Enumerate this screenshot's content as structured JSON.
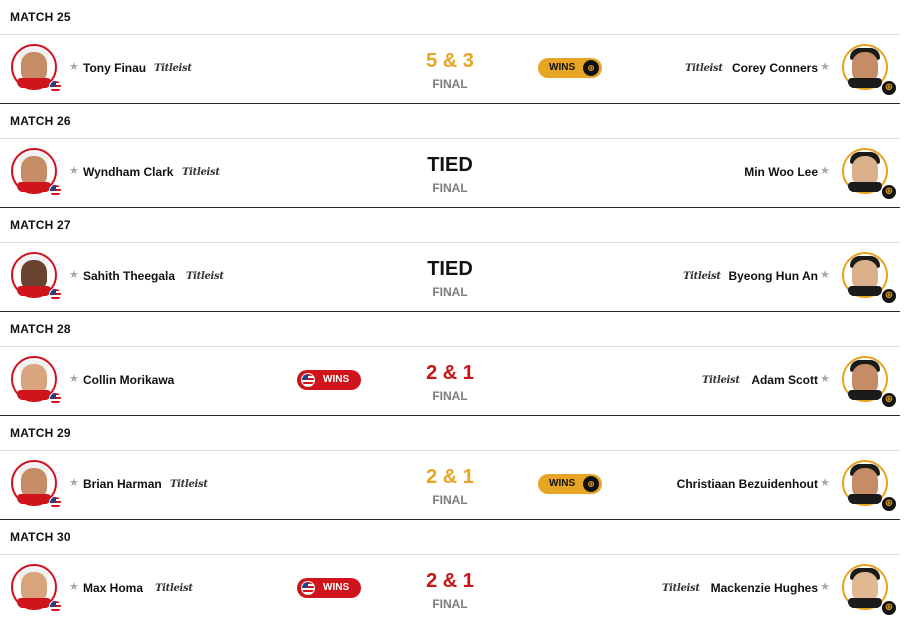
{
  "matches": [
    {
      "title": "MATCH 25",
      "usa_player": "Tony Finau",
      "intl_player": "Corey Conners",
      "score": "5 & 3",
      "score_team": "intl",
      "status": "FINAL",
      "winner": "intl",
      "usa_sponsor": "Titleist",
      "intl_sponsor": "Titleist"
    },
    {
      "title": "MATCH 26",
      "usa_player": "Wyndham Clark",
      "intl_player": "Min Woo Lee",
      "score": "TIED",
      "score_team": "tied",
      "status": "FINAL",
      "winner": "none",
      "usa_sponsor": "Titleist",
      "intl_sponsor": ""
    },
    {
      "title": "MATCH 27",
      "usa_player": "Sahith Theegala",
      "intl_player": "Byeong Hun An",
      "score": "TIED",
      "score_team": "tied",
      "status": "FINAL",
      "winner": "none",
      "usa_sponsor": "Titleist",
      "intl_sponsor": "Titleist"
    },
    {
      "title": "MATCH 28",
      "usa_player": "Collin Morikawa",
      "intl_player": "Adam Scott",
      "score": "2 & 1",
      "score_team": "usa",
      "status": "FINAL",
      "winner": "usa",
      "usa_sponsor": "",
      "intl_sponsor": "Titleist"
    },
    {
      "title": "MATCH 29",
      "usa_player": "Brian Harman",
      "intl_player": "Christiaan Bezuidenhout",
      "score": "2 & 1",
      "score_team": "intl",
      "status": "FINAL",
      "winner": "intl",
      "usa_sponsor": "Titleist",
      "intl_sponsor": ""
    },
    {
      "title": "MATCH 30",
      "usa_player": "Max Homa",
      "intl_player": "Mackenzie Hughes",
      "score": "2 & 1",
      "score_team": "usa",
      "status": "FINAL",
      "winner": "usa",
      "usa_sponsor": "Titleist",
      "intl_sponsor": "Titleist"
    }
  ],
  "wins_label": "WINS",
  "star_glyph": "★",
  "emblem_glyph": "⊕",
  "colors": {
    "usa_red": "#d0141b",
    "intl_gold": "#e8a524",
    "tied": "#111111",
    "status_gray": "#7c7c7c"
  },
  "icons": {
    "usa_avatar_badge": "usa-flag-icon",
    "intl_avatar_badge": "presidents-cup-emblem-icon",
    "star": "star-icon"
  }
}
